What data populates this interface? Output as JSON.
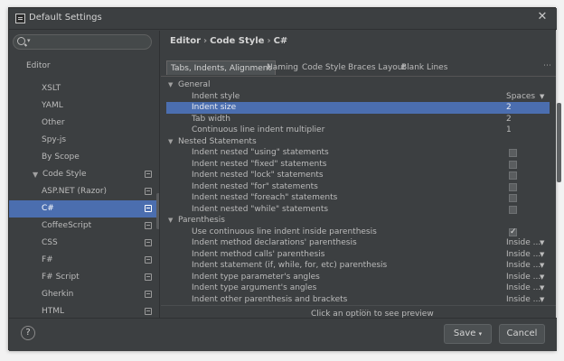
{
  "window": {
    "title": "Default Settings"
  },
  "sidebar": {
    "section_label": "Editor",
    "items": [
      {
        "label": "XSLT",
        "indent": 1,
        "has_icon": false
      },
      {
        "label": "YAML",
        "indent": 1,
        "has_icon": false
      },
      {
        "label": "Other",
        "indent": 1,
        "has_icon": false
      },
      {
        "label": "Spy-js",
        "indent": 1,
        "has_icon": false
      },
      {
        "label": "By Scope",
        "indent": 1,
        "has_icon": false
      },
      {
        "label": "Code Style",
        "indent": 0,
        "has_icon": true,
        "expander": "▼"
      },
      {
        "label": "ASP.NET (Razor)",
        "indent": 1,
        "has_icon": true
      },
      {
        "label": "C#",
        "indent": 1,
        "has_icon": true,
        "selected": true
      },
      {
        "label": "CoffeeScript",
        "indent": 1,
        "has_icon": true
      },
      {
        "label": "CSS",
        "indent": 1,
        "has_icon": true
      },
      {
        "label": "F#",
        "indent": 1,
        "has_icon": true
      },
      {
        "label": "F# Script",
        "indent": 1,
        "has_icon": true
      },
      {
        "label": "Gherkin",
        "indent": 1,
        "has_icon": true
      },
      {
        "label": "HTML",
        "indent": 1,
        "has_icon": true
      }
    ]
  },
  "breadcrumb": [
    "Editor",
    "Code Style",
    "C#"
  ],
  "tabs": [
    {
      "label": "Tabs, Indents, Alignment",
      "active": true
    },
    {
      "label": "Naming"
    },
    {
      "label": "Code Style"
    },
    {
      "label": "Braces Layout"
    },
    {
      "label": "Blank Lines"
    }
  ],
  "tab_menu_icon": "⋯",
  "options": [
    {
      "type": "section",
      "label": "General"
    },
    {
      "type": "option",
      "label": "Indent style",
      "value": "Spaces",
      "dropdown": true
    },
    {
      "type": "option",
      "label": "Indent size",
      "value": "2",
      "selected": true
    },
    {
      "type": "option",
      "label": "Tab width",
      "value": "2"
    },
    {
      "type": "option",
      "label": "Continuous line indent multiplier",
      "value": "1"
    },
    {
      "type": "section",
      "label": "Nested Statements"
    },
    {
      "type": "check",
      "label": "Indent nested \"using\" statements",
      "checked": false
    },
    {
      "type": "check",
      "label": "Indent nested \"fixed\" statements",
      "checked": false
    },
    {
      "type": "check",
      "label": "Indent nested \"lock\" statements",
      "checked": false
    },
    {
      "type": "check",
      "label": "Indent nested \"for\" statements",
      "checked": false
    },
    {
      "type": "check",
      "label": "Indent nested \"foreach\" statements",
      "checked": false
    },
    {
      "type": "check",
      "label": "Indent nested \"while\" statements",
      "checked": false
    },
    {
      "type": "section",
      "label": "Parenthesis"
    },
    {
      "type": "check",
      "label": "Use continuous line indent inside parenthesis",
      "checked": true
    },
    {
      "type": "option",
      "label": "Indent method declarations' parenthesis",
      "value": "Inside ...",
      "dropdown": true
    },
    {
      "type": "option",
      "label": "Indent method calls' parenthesis",
      "value": "Inside ...",
      "dropdown": true
    },
    {
      "type": "option",
      "label": "Indent statement (if, while, for, etc) parenthesis",
      "value": "Inside ...",
      "dropdown": true
    },
    {
      "type": "option",
      "label": "Indent type parameter's angles",
      "value": "Inside ...",
      "dropdown": true
    },
    {
      "type": "option",
      "label": "Indent type argument's angles",
      "value": "Inside ...",
      "dropdown": true
    },
    {
      "type": "option",
      "label": "Indent other parenthesis and brackets",
      "value": "Inside ...",
      "dropdown": true
    }
  ],
  "preview_text": "Click an option to see preview",
  "footer": {
    "help_label": "?",
    "save_label": "Save",
    "cancel_label": "Cancel"
  }
}
